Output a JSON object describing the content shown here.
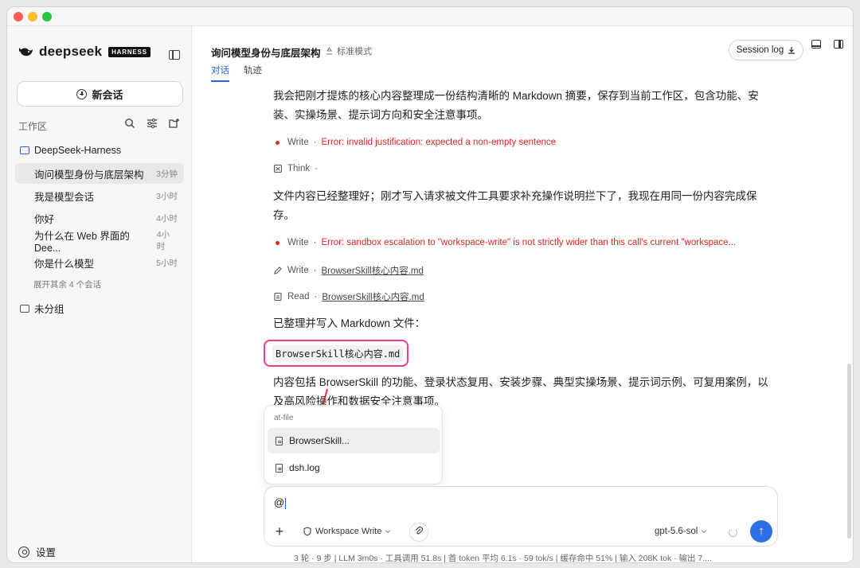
{
  "sidebar": {
    "brand": "deepseek",
    "brand_badge": "HARNESS",
    "new_chat": "新会话",
    "workspace_label": "工作区",
    "folder": "DeepSeek-Harness",
    "conversations": [
      {
        "title": "询问模型身份与底层架构",
        "time": "3分钟"
      },
      {
        "title": "我是模型会话",
        "time": "3小时"
      },
      {
        "title": "你好",
        "time": "4小时"
      },
      {
        "title": "为什么在 Web 界面的 Dee...",
        "time": "4小时"
      },
      {
        "title": "你是什么模型",
        "time": "5小时"
      }
    ],
    "expand_more": "展开其余 4 个会话",
    "ungrouped": "未分组",
    "settings": "设置"
  },
  "header": {
    "title": "询问模型身份与底层架构",
    "mode": "标准模式",
    "tabs": [
      "对话",
      "轨迹"
    ],
    "session_log": "Session log"
  },
  "messages": {
    "para1": "我会把刚才提炼的核心内容整理成一份结构清晰的 Markdown 摘要，保存到当前工作区，包含功能、安装、实操场景、提示词方向和安全注意事项。",
    "step1_action": "Write",
    "step1_error": "Error: invalid justification: expected a non-empty sentence",
    "step2_action": "Think",
    "para2": "文件内容已经整理好；刚才写入请求被文件工具要求补充操作说明拦下了，我现在用同一份内容完成保存。",
    "step3_action": "Write",
    "step3_error": "Error: sandbox escalation to \"workspace-write\" is not strictly wider than this call's current \"workspace...",
    "step4_action": "Write",
    "step4_file": "BrowserSkill核心内容.md",
    "step5_action": "Read",
    "step5_file": "BrowserSkill核心内容.md",
    "para3": "已整理并写入 Markdown 文件：",
    "code_file": "BrowserSkill核心内容.md",
    "para4": "内容包括 BrowserSkill 的功能、登录状态复用、安装步骤、典型实操场景、提示词示例、可复用案例，以及高风险操作和数据安全注意事项。",
    "separator": "·"
  },
  "popup": {
    "header": "at-file",
    "items": [
      "BrowserSkill...",
      "dsh.log"
    ]
  },
  "composer": {
    "value": "@",
    "permission": "Workspace Write",
    "model": "gpt-5.6-sol",
    "plus": "+",
    "send": "↑"
  },
  "status": {
    "line": "3 轮 · 9 步  |  LLM 3m0s · 工具调用 51.8s  |  首 token 平均 6.1s · 59 tok/s  |  缓存命中 51%  |  输入 208K tok · 输出 7...."
  },
  "colors": {
    "accent": "#2563eb",
    "error": "#dc2626",
    "highlight": "#e83e8c"
  }
}
